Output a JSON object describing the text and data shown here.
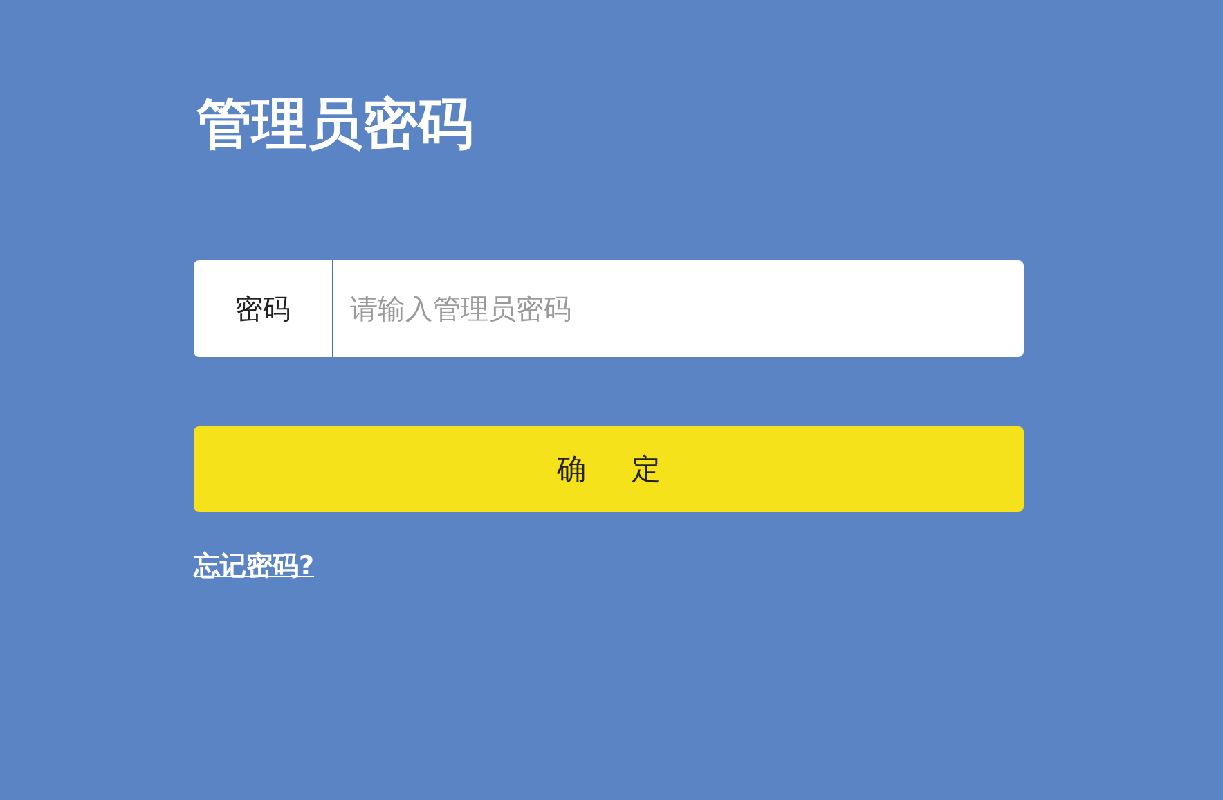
{
  "title": "管理员密码",
  "password": {
    "label": "密码",
    "placeholder": "请输入管理员密码"
  },
  "submit": "确 定",
  "forgot_link": "忘记密码?"
}
